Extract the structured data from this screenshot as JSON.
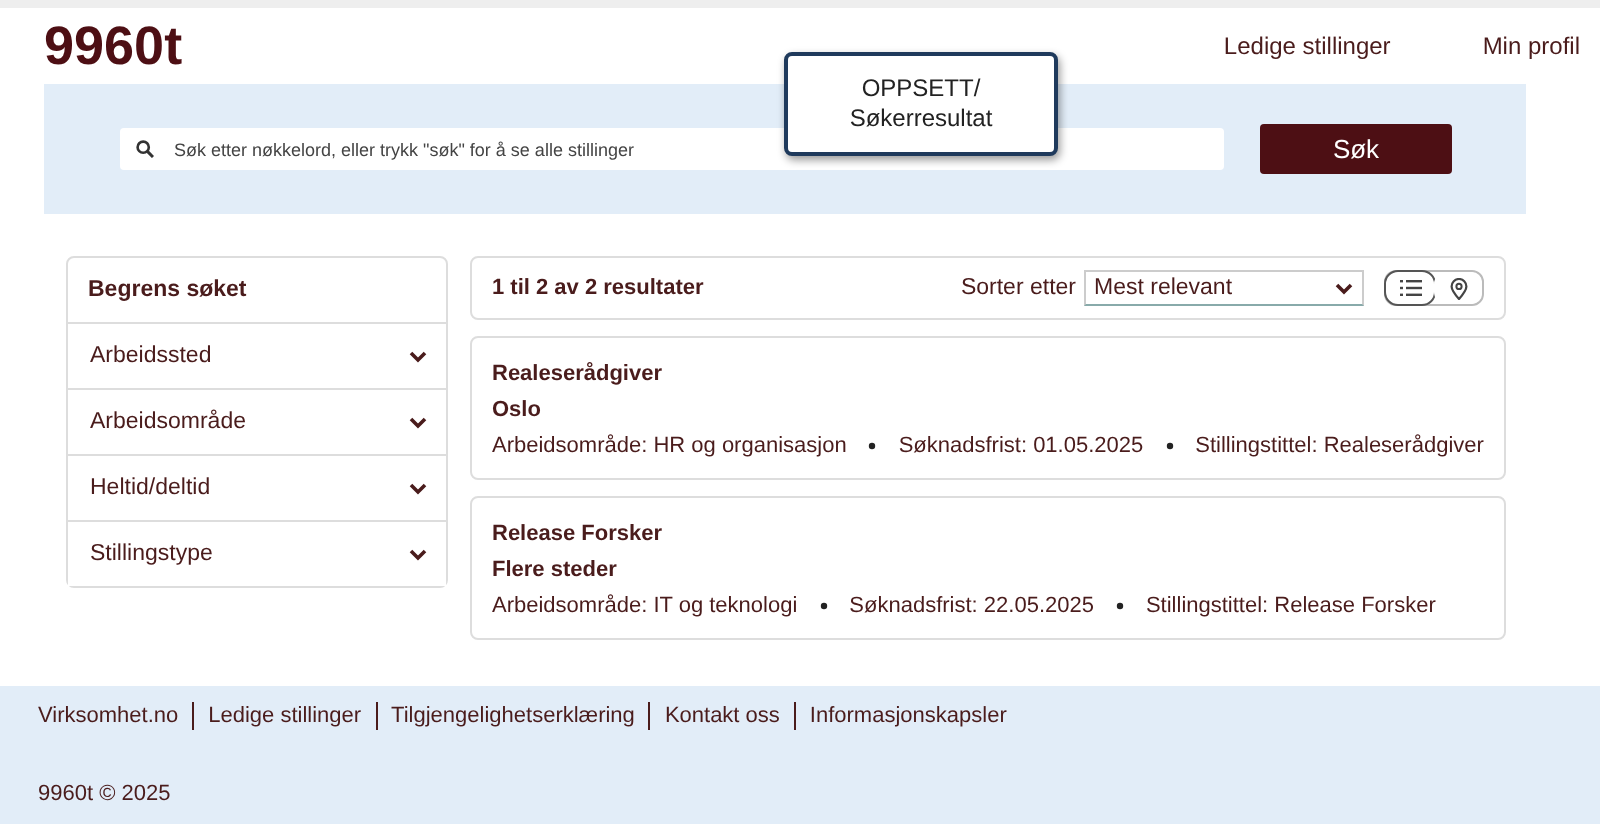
{
  "header": {
    "logo": "9960t",
    "nav": [
      "Ledige stillinger",
      "Min profil"
    ]
  },
  "callout": {
    "text": "OPPSETT/ Søkerresultat"
  },
  "search": {
    "placeholder": "Søk etter nøkkelord, eller trykk \"søk\" for å se alle stillinger",
    "button": "Søk"
  },
  "filters": {
    "title": "Begrens søket",
    "items": [
      {
        "label": "Arbeidssted",
        "expanded": false
      },
      {
        "label": "Arbeidsområde",
        "expanded": false
      },
      {
        "label": "Heltid/deltid",
        "expanded": false
      },
      {
        "label": "Stillingstype",
        "expanded": false
      }
    ]
  },
  "results": {
    "count": "1 til 2 av 2 resultater",
    "sort_label": "Sorter etter",
    "sort_value": "Mest relevant",
    "views": [
      {
        "kind": "list",
        "selected": true
      },
      {
        "kind": "map",
        "selected": false
      }
    ],
    "items": [
      {
        "title": "Realeserådgiver",
        "location": "Oslo",
        "meta": [
          "Arbeidsområde: HR og organisasjon",
          "Søknadsfrist: 01.05.2025",
          "Stillingstittel: Realeserådgiver"
        ]
      },
      {
        "title": "Release Forsker",
        "location": "Flere steder",
        "meta": [
          "Arbeidsområde: IT og teknologi",
          "Søknadsfrist: 22.05.2025",
          "Stillingstittel: Release Forsker"
        ]
      }
    ]
  },
  "footer": {
    "links": [
      "Virksomhet.no",
      "Ledige stillinger",
      "Tilgjengelighetserklæring",
      "Kontakt oss",
      "Informasjonskapsler"
    ],
    "copyright": "9960t © 2025"
  }
}
